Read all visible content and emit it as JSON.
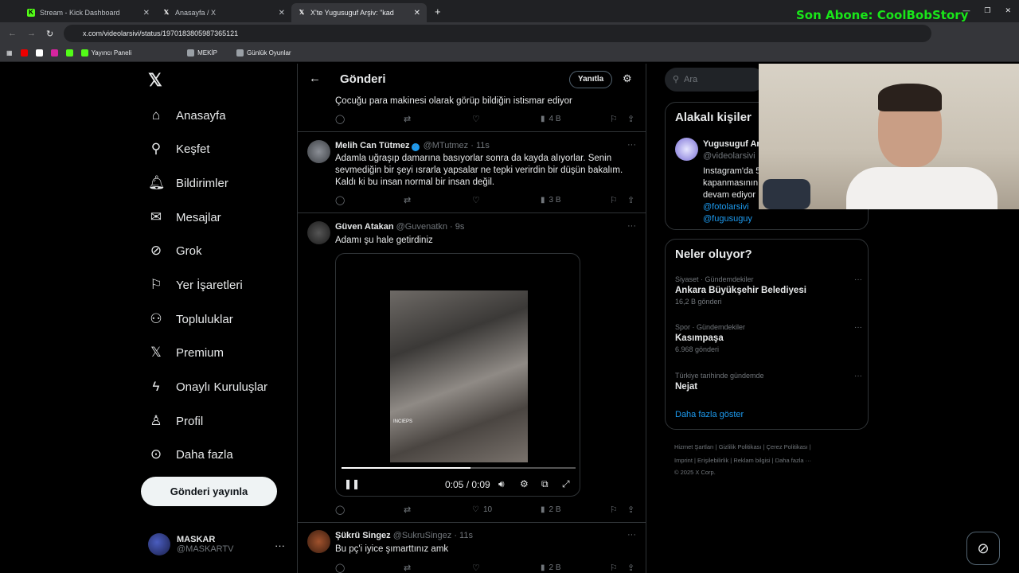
{
  "browser": {
    "tabs": [
      {
        "title": "Stream - Kick Dashboard"
      },
      {
        "title": "Anasayfa / X"
      },
      {
        "title": "X'te Yugusuguf Arşiv: \"kad"
      }
    ],
    "url": "x.com/videolarsivi/status/1970183805987365121",
    "bookmarks": [
      "Yayıncı Paneli",
      "MEKİP",
      "Günlük Oyunlar"
    ]
  },
  "overlay": {
    "subscriber": "Son Abone: CoolBobStory"
  },
  "nav": {
    "items": [
      "Anasayfa",
      "Keşfet",
      "Bildirimler",
      "Mesajlar",
      "Grok",
      "Yer İşaretleri",
      "Topluluklar",
      "Premium",
      "Onaylı Kuruluşlar",
      "Profil",
      "Daha fazla"
    ],
    "post_button": "Gönderi yayınla",
    "account_name": "MASKAR",
    "account_handle": "@MASKARTV"
  },
  "header": {
    "title": "Gönderi",
    "reply": "Yanıtla"
  },
  "tweets": [
    {
      "text": "Çocuğu para makinesi olarak görüp bildiğin istismar ediyor",
      "views": "4 B"
    },
    {
      "name": "Melih Can Tütmez",
      "handle": "@MTutmez · 11s",
      "text": "Adamla uğraşıp damarına basıyorlar sonra da kayda alıyorlar. Senin sevmediğin bir şeyi ısrarla yapsalar ne tepki verirdin bir düşün bakalım. Kaldı ki bu insan normal bir insan değil.",
      "views": "3 B"
    },
    {
      "name": "Güven Atakan",
      "handle": "@Guvenatkn · 9s",
      "text": "Adamı şu hale getirdiniz",
      "likes": "10",
      "views": "2 B"
    },
    {
      "name": "Şükrü Singez",
      "handle": "@SukruSingez · 11s",
      "text": "Bu pç'i iyice şımarttınız amk",
      "views": "2 B"
    }
  ],
  "video": {
    "time": "0:05 / 0:09",
    "progress": 0.55,
    "watermark": "INCIEPS"
  },
  "right": {
    "search_placeholder": "Ara",
    "related_title": "Alakalı kişiler",
    "related_name": "Yugusuguf Ar",
    "related_handle": "@videolarsivi",
    "related_bio1": "Instagram'da 5",
    "related_bio2": "kapanmasının",
    "related_bio3": "devam ediyor",
    "related_link1": "@fotolarsivi",
    "related_link2": "@fugusuguy",
    "trends_title": "Neler oluyor?",
    "trends": [
      {
        "cat": "Siyaset · Gündemdekiler",
        "name": "Ankara Büyükşehir Belediyesi",
        "posts": "16,2 B gönderi"
      },
      {
        "cat": "Spor · Gündemdekiler",
        "name": "Kasımpaşa",
        "posts": "6.968 gönderi"
      },
      {
        "cat": "Türkiye tarihinde gündemde",
        "name": "Nejat",
        "posts": ""
      }
    ],
    "show_more": "Daha fazla göster",
    "footer1": "Hizmet Şartları  |  Gizlilik Politikası  |  Çerez Politikası  |",
    "footer2": "Imprint  |  Erişilebilirlik  |  Reklam bilgisi  |  Daha fazla ···",
    "footer3": "© 2025 X Corp."
  }
}
